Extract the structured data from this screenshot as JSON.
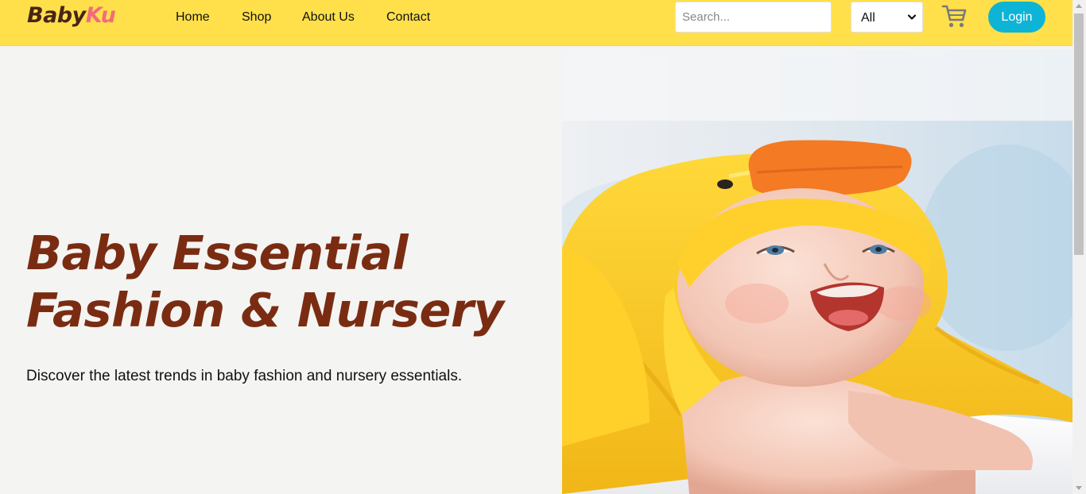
{
  "brand": {
    "part1": "Baby",
    "part2": "Ku"
  },
  "nav": {
    "links": [
      {
        "label": "Home"
      },
      {
        "label": "Shop"
      },
      {
        "label": "About Us"
      },
      {
        "label": "Contact"
      }
    ]
  },
  "search": {
    "placeholder": "Search...",
    "value": ""
  },
  "category": {
    "selected": "All"
  },
  "cart": {
    "icon": "cart-icon"
  },
  "login": {
    "label": "Login"
  },
  "hero": {
    "title_line1": "Baby Essential",
    "title_line2": "Fashion & Nursery",
    "subtitle": "Discover the latest trends in baby fashion and nursery essentials."
  },
  "colors": {
    "navbar": "#ffe04b",
    "brand_dark": "#4a2416",
    "brand_pink": "#f26b7d",
    "login_button": "#0db4d6",
    "hero_title": "#7a2c12",
    "hero_bg": "#f4f4f2"
  }
}
